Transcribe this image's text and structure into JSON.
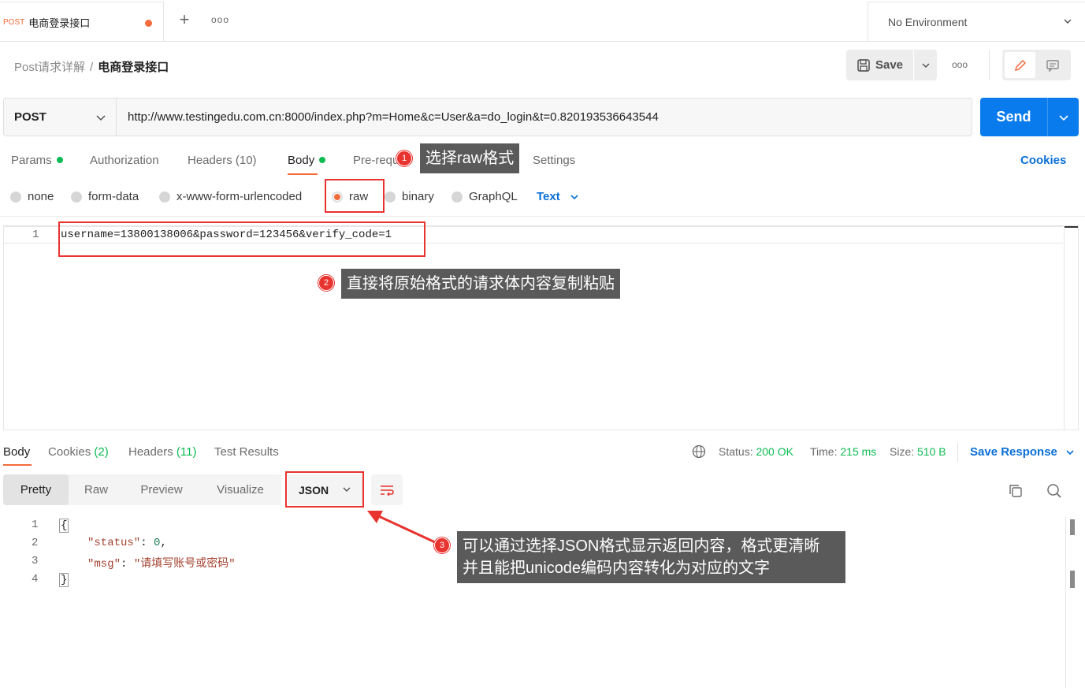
{
  "tabbar": {
    "tab_method": "POST",
    "tab_name": "电商登录接口",
    "environment": "No Environment",
    "more": "ooo"
  },
  "header": {
    "breadcrumb_parent": "Post请求详解",
    "breadcrumb_sep": "/",
    "breadcrumb_current": "电商登录接口",
    "save_label": "Save",
    "more": "ooo"
  },
  "request": {
    "method": "POST",
    "url": "http://www.testingedu.com.cn:8000/index.php?m=Home&c=User&a=do_login&t=0.820193536643544",
    "send_label": "Send"
  },
  "request_tabs": {
    "params": "Params",
    "authorization": "Authorization",
    "headers": "Headers",
    "headers_count": "(10)",
    "body": "Body",
    "prerequest": "Pre-requ",
    "settings": "Settings",
    "cookies": "Cookies"
  },
  "body_types": {
    "none": "none",
    "form_data": "form-data",
    "urlencoded": "x-www-form-urlencoded",
    "raw": "raw",
    "binary": "binary",
    "graphql": "GraphQL",
    "text_format": "Text"
  },
  "editor": {
    "line_number": "1",
    "line_text": "username=13800138006&password=123456&verify_code=1"
  },
  "response_tabs": {
    "body": "Body",
    "cookies": "Cookies",
    "cookies_count": "(2)",
    "headers": "Headers",
    "headers_count": "(11)",
    "test_results": "Test Results"
  },
  "response_meta": {
    "status_label": "Status:",
    "status_value": "200 OK",
    "time_label": "Time:",
    "time_value": "215 ms",
    "size_label": "Size:",
    "size_value": "510 B",
    "save_response": "Save Response"
  },
  "response_view": {
    "pretty": "Pretty",
    "raw": "Raw",
    "preview": "Preview",
    "visualize": "Visualize",
    "format": "JSON"
  },
  "response_body": {
    "line_numbers": [
      "1",
      "2",
      "3",
      "4"
    ],
    "open_brace": "{",
    "close_brace": "}",
    "status_key": "\"status\"",
    "status_val": "0",
    "msg_key": "\"msg\"",
    "msg_val": "\"请填写账号或密码\""
  },
  "annotations": {
    "badge1": "1",
    "callout1": "选择raw格式",
    "badge2": "2",
    "callout2": "直接将原始格式的请求体内容复制粘贴",
    "badge3": "3",
    "callout3_line1": "可以通过选择JSON格式显示返回内容，格式更清晰",
    "callout3_line2": "并且能把unicode编码内容转化为对应的文字"
  },
  "colors": {
    "accent_orange": "#f26b3a",
    "send_blue": "#097bed",
    "link_blue": "#0a6fd6",
    "status_green": "#0cbb52",
    "annotation_red": "#e8332f"
  }
}
